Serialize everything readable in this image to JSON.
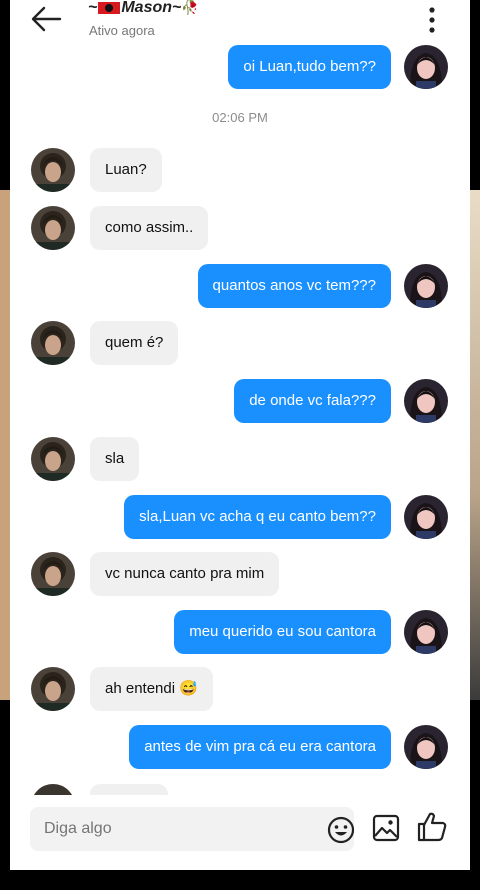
{
  "header": {
    "title_prefix": "~",
    "title_name": "Mason~",
    "rose": "🥀",
    "status": "Ativo agora",
    "back_icon": "arrow-left-icon",
    "more_icon": "more-vertical-icon"
  },
  "timestamp": "02:06 PM",
  "messages": [
    {
      "side": "out",
      "text": "oi Luan,tudo bem??"
    },
    {
      "side": "in",
      "text": "Luan?"
    },
    {
      "side": "in",
      "text": "como assim.."
    },
    {
      "side": "out",
      "text": "quantos anos vc tem???"
    },
    {
      "side": "in",
      "text": "quem é?"
    },
    {
      "side": "out",
      "text": "de onde vc fala???"
    },
    {
      "side": "in",
      "text": "sla"
    },
    {
      "side": "out",
      "text": "sla,Luan vc acha q eu canto bem??"
    },
    {
      "side": "in",
      "text": "vc nunca canto pra mim"
    },
    {
      "side": "out",
      "text": "meu querido eu sou cantora"
    },
    {
      "side": "in",
      "text": "ah entendi 😅"
    },
    {
      "side": "out",
      "text": "antes de vim pra cá eu era cantora"
    }
  ],
  "composer": {
    "placeholder": "Diga algo",
    "emoji_icon": "emoji-icon",
    "image_icon": "image-icon",
    "like_icon": "thumbs-up-icon"
  },
  "colors": {
    "outgoing_bubble": "#1a90ff",
    "incoming_bubble": "#f0f0f0",
    "background": "#ffffff"
  }
}
